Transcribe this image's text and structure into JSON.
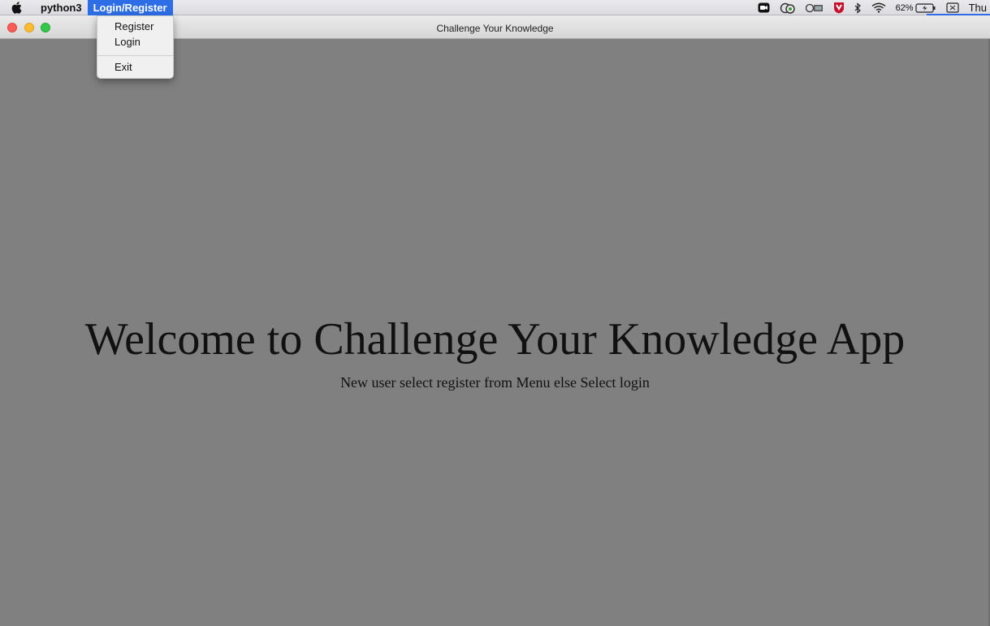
{
  "menubar": {
    "apple_icon": "apple-logo-icon",
    "app_name": "python3",
    "menus": [
      {
        "label": "Login/Register",
        "active": true
      }
    ],
    "status": {
      "icons": [
        "camera-icon",
        "creative-cloud-icon",
        "display-icon",
        "mcafee-shield-icon",
        "bluetooth-icon",
        "wifi-icon"
      ],
      "battery_percent": "62%",
      "clock": "Thu"
    }
  },
  "window": {
    "title": "Challenge Your Knowledge"
  },
  "dropdown": {
    "items": [
      {
        "label": "Register"
      },
      {
        "label": "Login"
      },
      {
        "label": "Exit"
      }
    ]
  },
  "main": {
    "heading": "Welcome to Challenge Your Knowledge App",
    "subtitle": "New user select register from Menu else Select login"
  },
  "colors": {
    "background": "#808080",
    "menu_highlight": "#2d6ee6",
    "traffic_close": "#fc5c56",
    "traffic_minimize": "#fdbc2e",
    "traffic_maximize": "#34c84a"
  }
}
